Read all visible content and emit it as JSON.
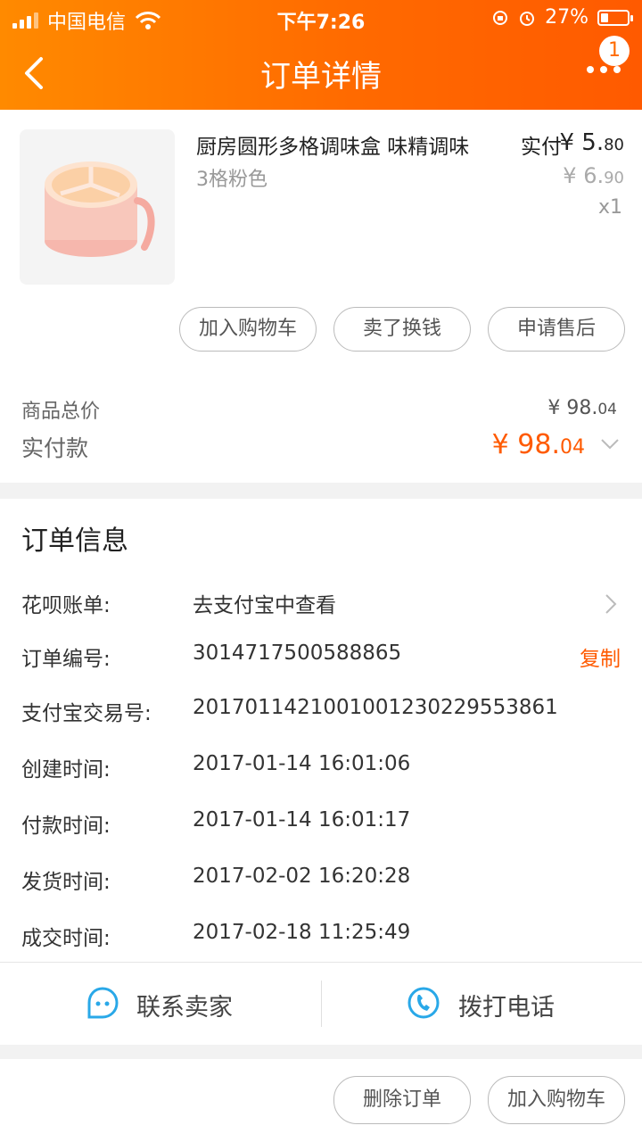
{
  "status_bar": {
    "carrier": "中国电信",
    "time": "下午7:26",
    "battery": "27%",
    "battery_level": 0.27
  },
  "nav": {
    "title": "订单详情",
    "badge": "1"
  },
  "product": {
    "name": "厨房圆形多格调味盒 味精调味",
    "spec": "3格粉色",
    "paid_label": "实付",
    "paid_int": "¥ 5.",
    "paid_dec": "80",
    "orig_int": "¥ 6.",
    "orig_dec": "90",
    "qty": "x1",
    "buttons": [
      "加入购物车",
      "卖了换钱",
      "申请售后"
    ]
  },
  "totals": {
    "goods_label": "商品总价",
    "goods_int": "¥ 98.",
    "goods_dec": "04",
    "paid_label": "实付款",
    "paid_int": "¥ 98.",
    "paid_dec": "04"
  },
  "order_info": {
    "title": "订单信息",
    "rows": [
      {
        "key": "花呗账单:",
        "value": "去支付宝中查看"
      },
      {
        "key": "订单编号:",
        "value": "3014717500588865",
        "action": "复制"
      },
      {
        "key": "支付宝交易号:",
        "value": "2017011421001001230229553861"
      },
      {
        "key": "创建时间:",
        "value": "2017-01-14 16:01:06"
      },
      {
        "key": "付款时间:",
        "value": "2017-01-14 16:01:17"
      },
      {
        "key": "发货时间:",
        "value": "2017-02-02 16:20:28"
      },
      {
        "key": "成交时间:",
        "value": "2017-02-18 11:25:49"
      }
    ],
    "contact_seller": "联系卖家",
    "call_phone": "拨打电话"
  },
  "footer": {
    "delete_order": "删除订单",
    "add_to_cart": "加入购物车"
  },
  "colors": {
    "accent": "#ff5a00",
    "header_start": "#ff8a00",
    "icon_blue": "#29a8e8"
  }
}
